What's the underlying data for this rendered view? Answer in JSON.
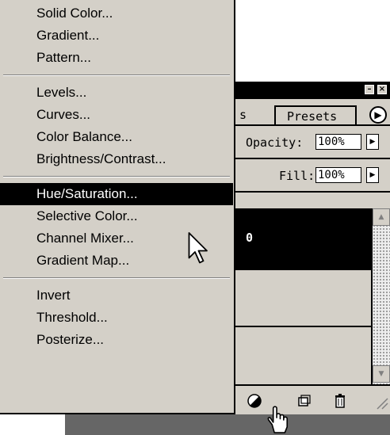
{
  "menu": {
    "groups": [
      [
        "Solid Color...",
        "Gradient...",
        "Pattern..."
      ],
      [
        "Levels...",
        "Curves...",
        "Color Balance...",
        "Brightness/Contrast..."
      ],
      [
        "Hue/Saturation...",
        "Selective Color...",
        "Channel Mixer...",
        "Gradient Map..."
      ],
      [
        "Invert",
        "Threshold...",
        "Posterize..."
      ]
    ],
    "highlighted": "Hue/Saturation..."
  },
  "panel": {
    "window_buttons": {
      "minimize": "–",
      "close": "×"
    },
    "tabs": {
      "prev_partial": "s",
      "presets": "Presets",
      "menu_arrow": "▶"
    },
    "opacity": {
      "label": "Opacity:",
      "value": "100%",
      "arrow": "▶"
    },
    "fill": {
      "label": "Fill:",
      "value": "100%",
      "arrow": "▶"
    },
    "selected_layer_name": "0",
    "scroll": {
      "up": "▲",
      "down": "▼"
    },
    "bottom_icons": [
      "adjustment-layer-icon",
      "new-layer-icon",
      "trash-icon"
    ]
  },
  "colors": {
    "menu_bg": "#d4d0c8",
    "highlight_bg": "#000000",
    "highlight_text": "#ffffff",
    "panel_bg": "#d4d0c8"
  }
}
